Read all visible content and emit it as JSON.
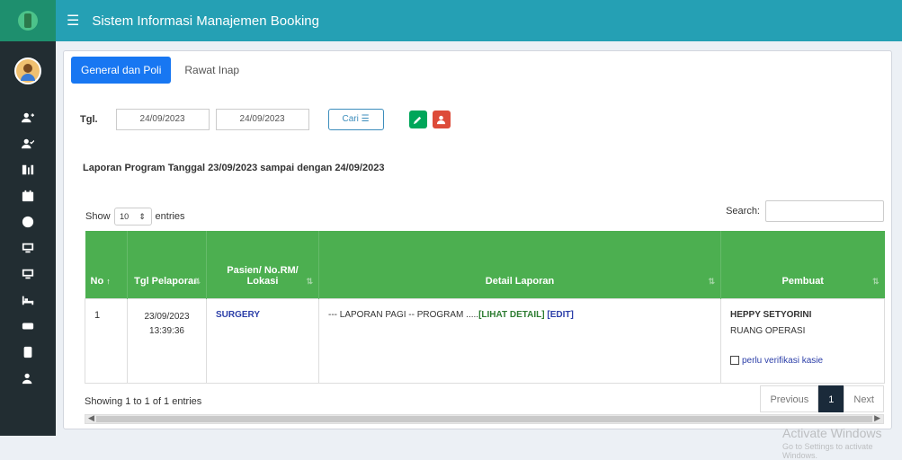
{
  "header": {
    "title": "Sistem Informasi Manajemen Booking"
  },
  "tabs": [
    {
      "label": "General dan Poli"
    },
    {
      "label": "Rawat Inap"
    }
  ],
  "filter": {
    "label": "Tgl.",
    "date_from": "24/09/2023",
    "date_to": "24/09/2023",
    "search_button": "Cari"
  },
  "report_title": "Laporan Program Tanggal 23/09/2023 sampai dengan 24/09/2023",
  "table_controls": {
    "show_label": "Show",
    "entries_value": "10",
    "entries_label": "entries",
    "search_label": "Search:"
  },
  "table": {
    "headers": [
      "No",
      "Tgl Pelaporan",
      "Pasien/ No.RM/ Lokasi",
      "Detail Laporan",
      "Pembuat"
    ],
    "rows": [
      {
        "no": "1",
        "tgl_date": "23/09/2023",
        "tgl_time": "13:39:36",
        "pasien": "SURGERY",
        "detail_text": "--- LAPORAN PAGI -- PROGRAM .....",
        "lihat_detail": "[LIHAT DETAIL]",
        "edit": "[EDIT]",
        "pembuat_nama": "HEPPY SETYORINI",
        "pembuat_ruang": "RUANG OPERASI",
        "verifikasi": "perlu verifikasi kasie"
      }
    ]
  },
  "footer": {
    "showing": "Showing 1 to 1 of 1 entries",
    "previous": "Previous",
    "page": "1",
    "next": "Next"
  },
  "watermark": {
    "line1": "Activate Windows",
    "line2": "Go to Settings to activate Windows."
  },
  "colors": {
    "topbar": "#25a0b4",
    "sidebar": "#222d32",
    "table_header": "#4caf50",
    "tab_active": "#1877f2"
  }
}
